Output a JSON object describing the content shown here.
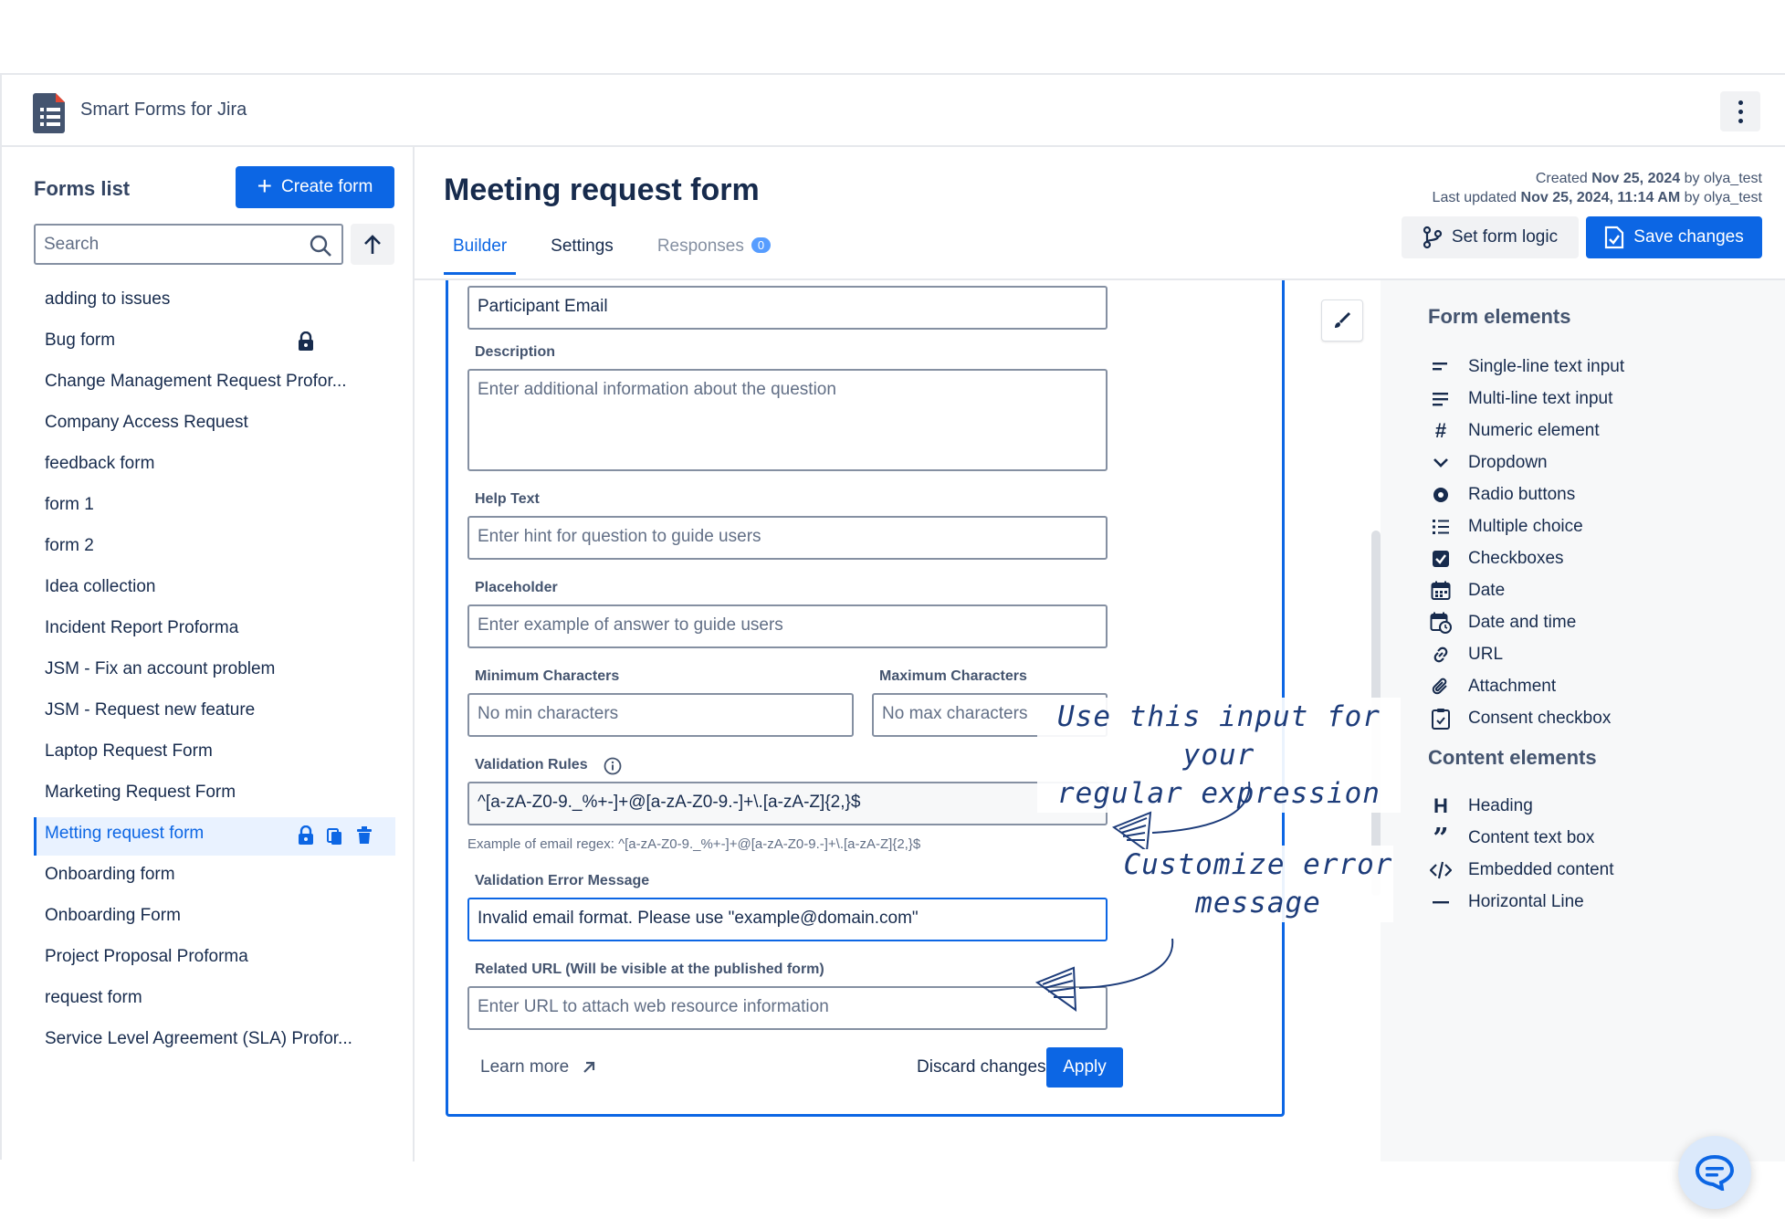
{
  "app": {
    "title": "Smart Forms for Jira"
  },
  "sidebar": {
    "title": "Forms list",
    "create_label": "Create form",
    "search_placeholder": "Search",
    "items": [
      {
        "label": "adding to issues"
      },
      {
        "label": "Bug form",
        "locked": true
      },
      {
        "label": "Change Management Request Profor..."
      },
      {
        "label": "Company Access Request"
      },
      {
        "label": "feedback form"
      },
      {
        "label": "form 1"
      },
      {
        "label": "form 2"
      },
      {
        "label": "Idea collection"
      },
      {
        "label": "Incident Report Proforma"
      },
      {
        "label": "JSM - Fix an account problem"
      },
      {
        "label": "JSM - Request new feature"
      },
      {
        "label": "Laptop Request Form"
      },
      {
        "label": "Marketing Request Form"
      },
      {
        "label": "Metting request form",
        "active": true
      },
      {
        "label": "Onboarding form"
      },
      {
        "label": "Onboarding Form"
      },
      {
        "label": "Project Proposal Proforma"
      },
      {
        "label": "request form"
      },
      {
        "label": "Service Level Agreement (SLA) Profor..."
      }
    ]
  },
  "main": {
    "title": "Meeting request form",
    "meta": {
      "created_prefix": "Created",
      "created_date": "Nov 25, 2024",
      "created_by": "by olya_test",
      "updated_prefix": "Last updated",
      "updated_date": "Nov 25, 2024, 11:14 AM",
      "updated_by": "by olya_test"
    },
    "tabs": [
      {
        "label": "Builder"
      },
      {
        "label": "Settings"
      },
      {
        "label": "Responses",
        "count": "0"
      }
    ],
    "set_logic_label": "Set form logic",
    "save_label": "Save changes"
  },
  "editor": {
    "question_value": "Participant Email",
    "description_label": "Description",
    "description_placeholder": "Enter additional information about the question",
    "help_label": "Help Text",
    "help_placeholder": "Enter hint for question to guide users",
    "placeholder_label": "Placeholder",
    "placeholder_placeholder": "Enter example of answer to guide users",
    "min_label": "Minimum Characters",
    "min_placeholder": "No min characters",
    "max_label": "Maximum Characters",
    "max_placeholder": "No max characters",
    "validation_label": "Validation Rules",
    "validation_value": "^[a-zA-Z0-9._%+-]+@[a-zA-Z0-9.-]+\\.[a-zA-Z]{2,}$",
    "validation_hint": "Example of email regex: ^[a-zA-Z0-9._%+-]+@[a-zA-Z0-9.-]+\\.[a-zA-Z]{2,}$",
    "error_label": "Validation Error Message",
    "error_value": "Invalid email format. Please use \"example@domain.com\"",
    "url_label": "Related URL (Will be visible at the published form)",
    "url_placeholder": "Enter URL to attach web resource information",
    "learn_more": "Learn more",
    "discard_label": "Discard changes",
    "apply_label": "Apply"
  },
  "panel": {
    "form_elements_title": "Form elements",
    "form_elements": [
      {
        "label": "Single-line text input",
        "icon": "short-text-icon"
      },
      {
        "label": "Multi-line text input",
        "icon": "long-text-icon"
      },
      {
        "label": "Numeric element",
        "icon": "hash-icon"
      },
      {
        "label": "Dropdown",
        "icon": "chevron-down-icon"
      },
      {
        "label": "Radio buttons",
        "icon": "radio-icon"
      },
      {
        "label": "Multiple choice",
        "icon": "list-icon"
      },
      {
        "label": "Checkboxes",
        "icon": "checkbox-icon"
      },
      {
        "label": "Date",
        "icon": "calendar-icon"
      },
      {
        "label": "Date and time",
        "icon": "calendar-clock-icon"
      },
      {
        "label": "URL",
        "icon": "link-icon"
      },
      {
        "label": "Attachment",
        "icon": "paperclip-icon"
      },
      {
        "label": "Consent checkbox",
        "icon": "clipboard-check-icon"
      }
    ],
    "content_elements_title": "Content elements",
    "content_elements": [
      {
        "label": "Heading",
        "icon": "heading-icon"
      },
      {
        "label": "Content text box",
        "icon": "quote-icon"
      },
      {
        "label": "Embedded content",
        "icon": "code-icon"
      },
      {
        "label": "Horizontal Line",
        "icon": "horizontal-line-icon"
      }
    ]
  },
  "annotations": {
    "regex_note_line1": "Use this input for your",
    "regex_note_line2": "regular expression",
    "error_note_line1": "Customize error",
    "error_note_line2": "message"
  },
  "colors": {
    "accent": "#0c66e4",
    "annotation": "#1d3c7a"
  }
}
